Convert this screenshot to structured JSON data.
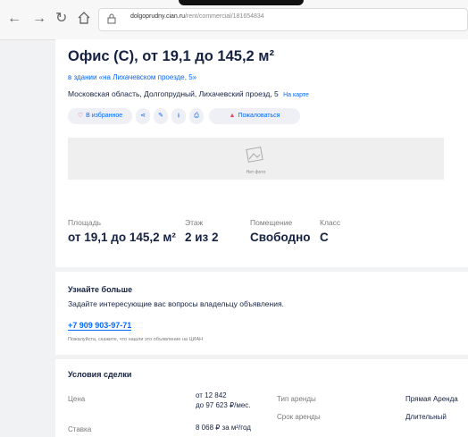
{
  "browser": {
    "url_host": "dolgoprudny.cian.ru",
    "url_path": "/rent/commercial/181654834"
  },
  "listing": {
    "title": "Офис (С), от 19,1 до 145,2 м²",
    "building_link": "в здании «на Лихачевском проезде, 5»",
    "address": "Московская область, Долгопрудный, Лихачевский проезд, 5",
    "map_link": "На карте",
    "actions": {
      "favorite": "В избранное",
      "complain": "Пожаловаться"
    },
    "no_photo": "Нет фото",
    "stats": [
      {
        "label": "Площадь",
        "value": "от 19,1 до 145,2 м²"
      },
      {
        "label": "Этаж",
        "value": "2 из 2"
      },
      {
        "label": "Помещение",
        "value": "Свободно"
      },
      {
        "label": "Класс",
        "value": "С"
      }
    ]
  },
  "contact": {
    "heading": "Узнайте больше",
    "text": "Задайте интересующие вас вопросы владельцу объявления.",
    "phone": "+7 909 903-97-71",
    "note": "Пожалуйста, скажите, что нашли это объявление на ЦИАН"
  },
  "deal": {
    "heading": "Условия сделки",
    "left": [
      {
        "label": "Цена",
        "value1": "от 12 842",
        "value2": "до 97 623 ₽/мес."
      },
      {
        "label": "Ставка",
        "value1": "8 068 ₽ за м²/год",
        "value2": ""
      }
    ],
    "right": [
      {
        "label": "Тип аренды",
        "value": "Прямая Аренда"
      },
      {
        "label": "Срок аренды",
        "value": "Длительный"
      }
    ]
  },
  "colors": {
    "accent": "#0468ff",
    "text": "#152242",
    "danger": "#e84260"
  }
}
